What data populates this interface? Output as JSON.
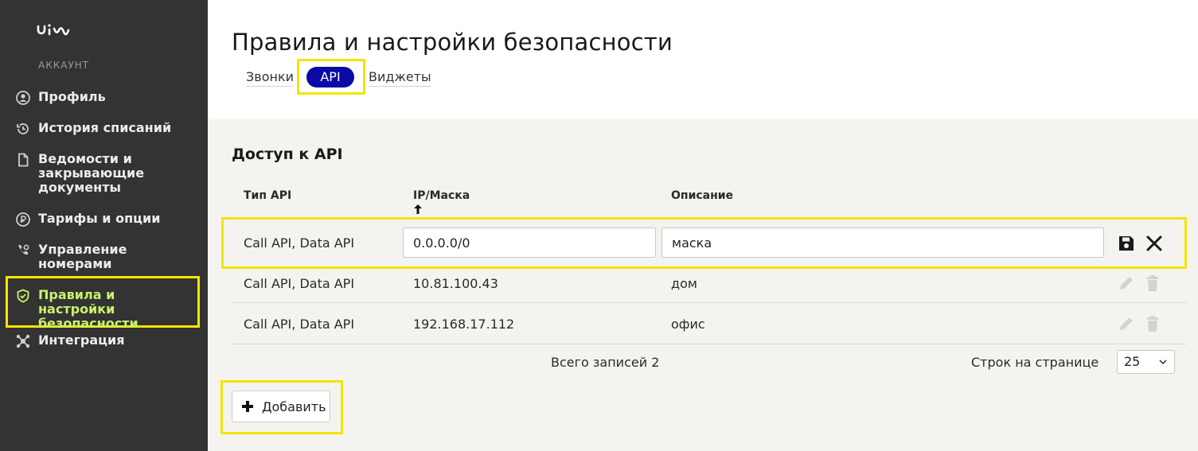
{
  "sidebar": {
    "logo": "uis",
    "section_label": "АККАУНТ",
    "items": [
      {
        "label": "Профиль",
        "icon": "user-circle-icon"
      },
      {
        "label": "История списаний",
        "icon": "history-icon"
      },
      {
        "label": "Ведомости и закрывающие документы",
        "icon": "document-icon"
      },
      {
        "label": "Тарифы и опции",
        "icon": "tariff-icon"
      },
      {
        "label": "Управление номерами",
        "icon": "phone-settings-icon"
      },
      {
        "label": "Правила и настройки безопасности",
        "icon": "shield-check-icon",
        "active": true
      },
      {
        "label": "Интеграция",
        "icon": "integration-icon"
      }
    ]
  },
  "header": {
    "title": "Правила и настройки безопасности",
    "tabs": [
      {
        "label": "Звонки"
      },
      {
        "label": "API",
        "active": true
      },
      {
        "label": "Виджеты"
      }
    ]
  },
  "main": {
    "section_title": "Доступ к API",
    "columns": [
      "Тип API",
      "IP/Маска",
      "Описание"
    ],
    "edit_row": {
      "type": "Call API, Data API",
      "ip_value": "0.0.0.0/0",
      "description_value": "маска"
    },
    "rows": [
      {
        "type": "Call API, Data API",
        "ip": "10.81.100.43",
        "description": "дом"
      },
      {
        "type": "Call API, Data API",
        "ip": "192.168.17.112",
        "description": "офис"
      }
    ],
    "total_records": "Всего записей 2",
    "rows_per_page_label": "Строк на странице",
    "rows_per_page_value": "25",
    "add_button_label": "Добавить"
  },
  "colors": {
    "sidebar_bg": "#333333",
    "active_nav": "#c9f26b",
    "tab_active_bg": "#0a0aa8",
    "highlight_frame": "#f3e500",
    "content_bg": "#f4f3ef"
  }
}
